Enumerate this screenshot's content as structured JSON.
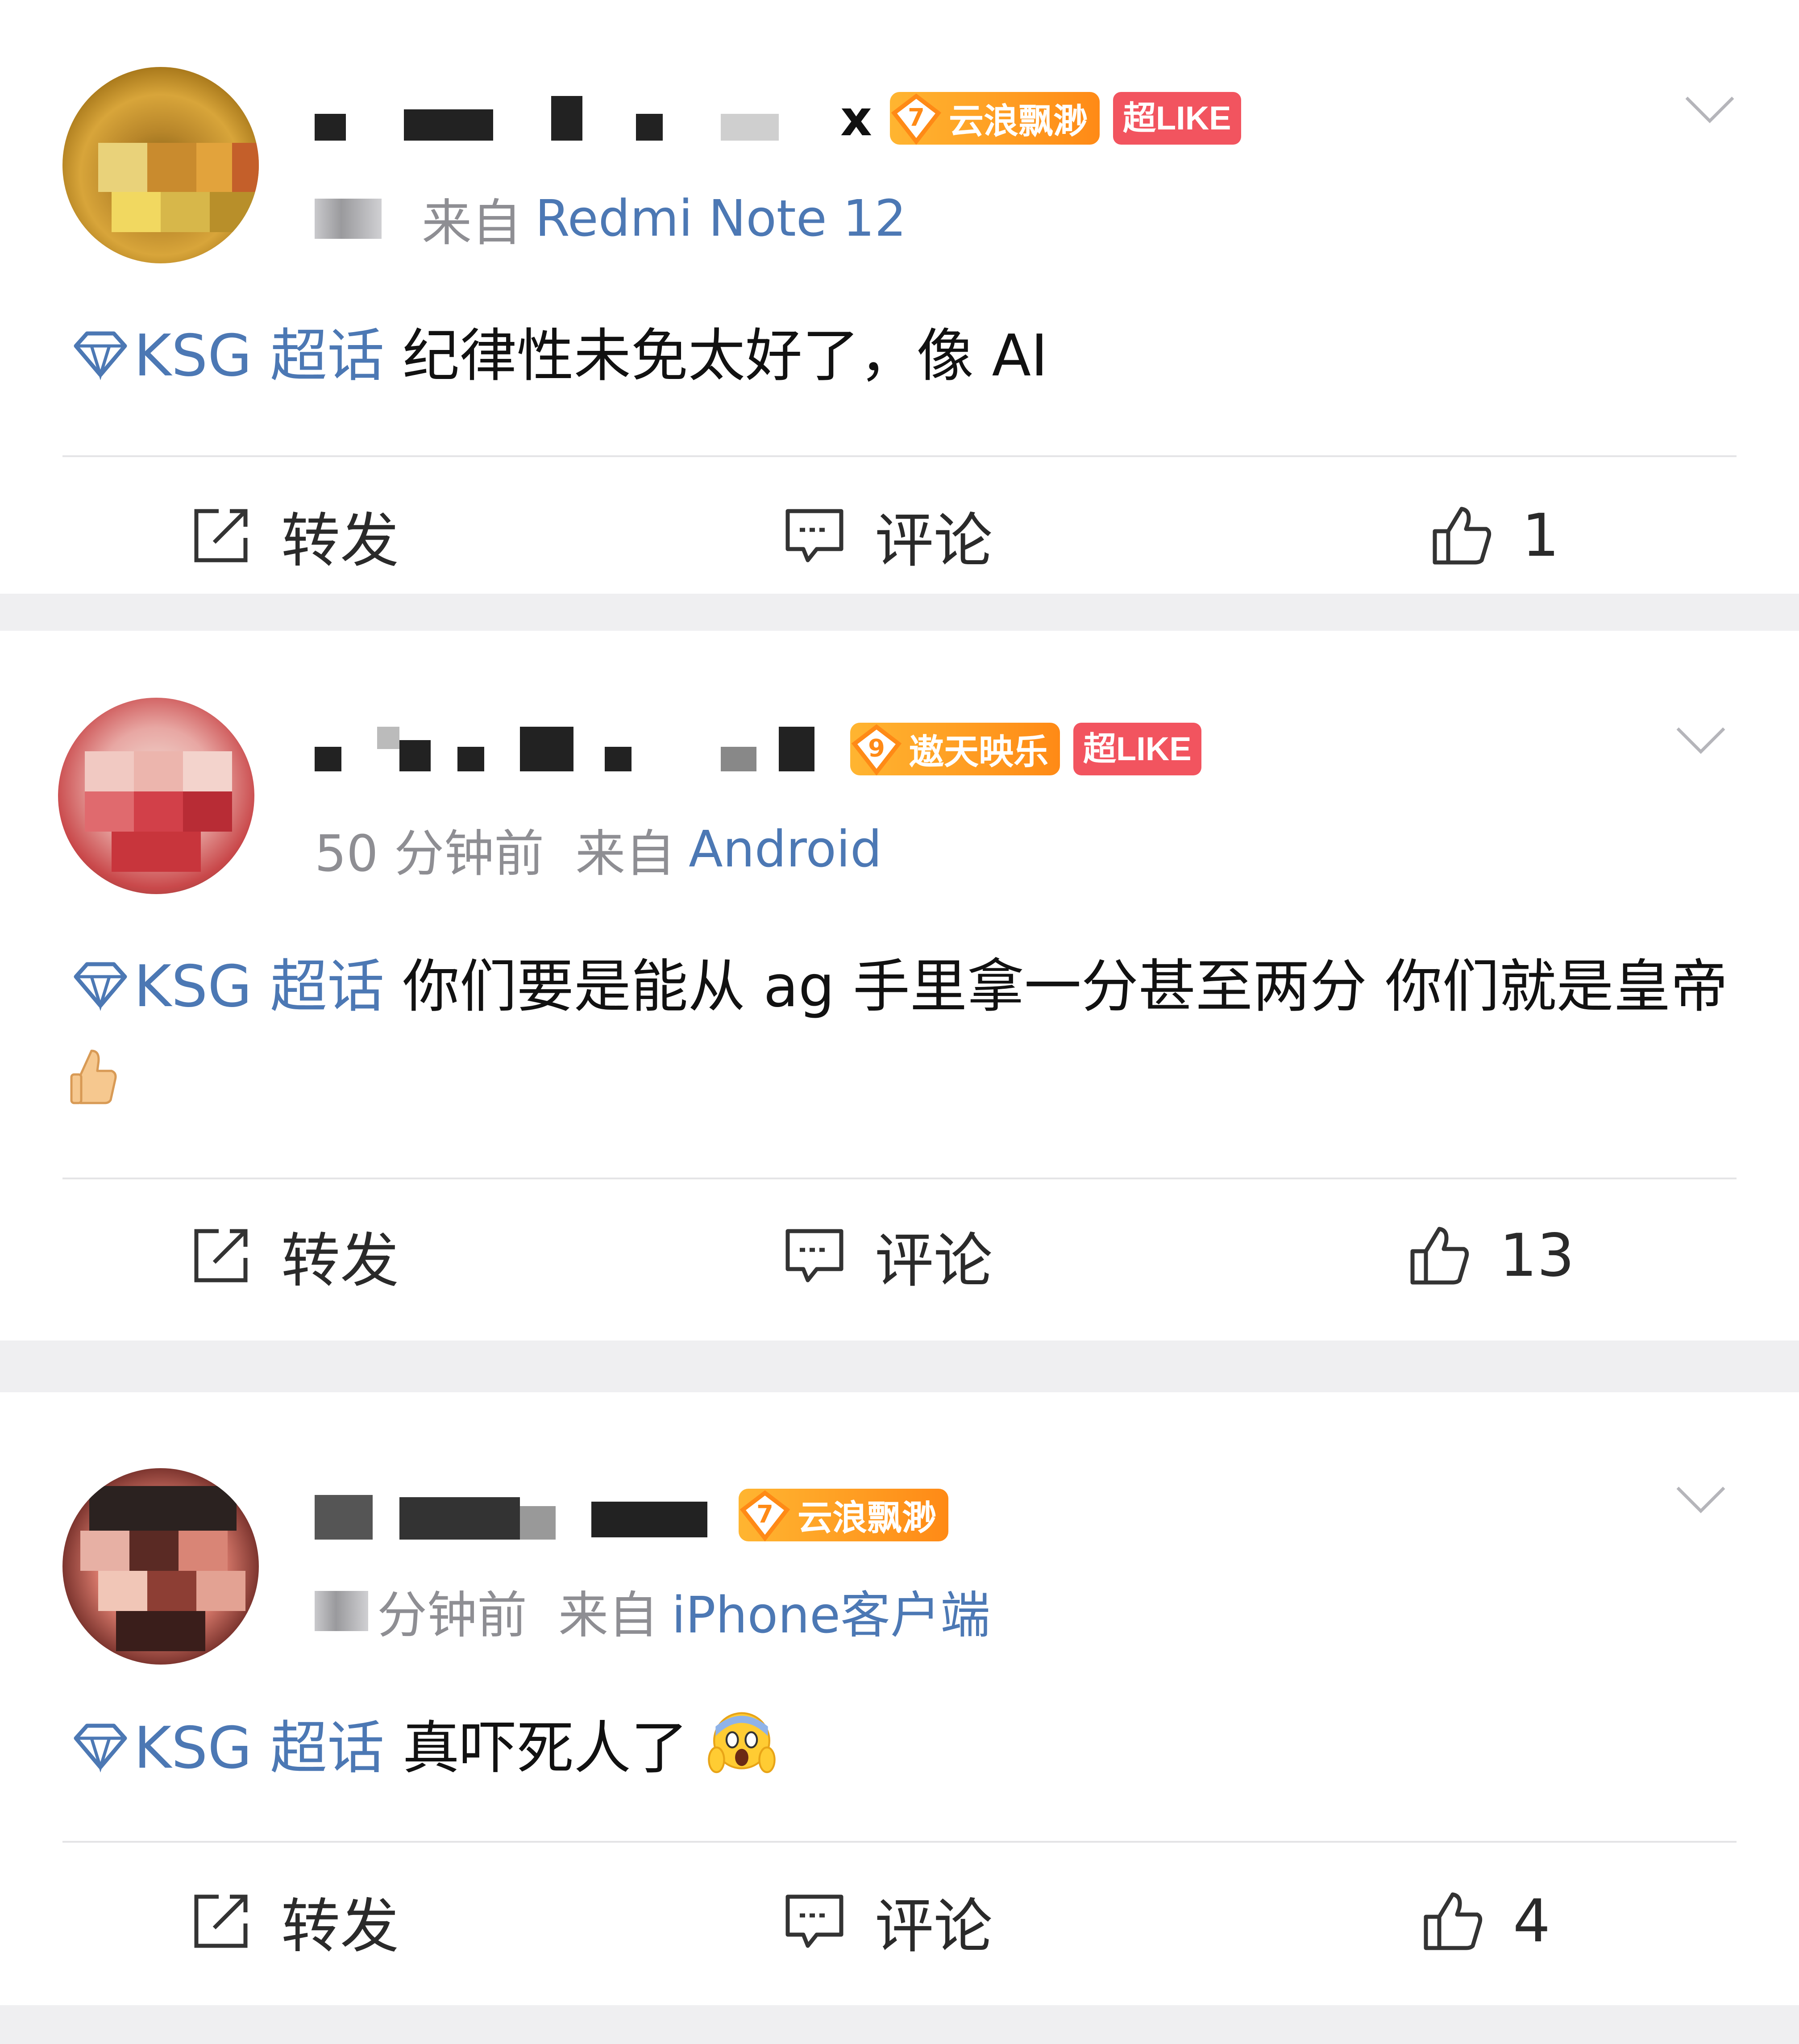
{
  "feed": {
    "posts": [
      {
        "user_name_visible_suffix": "x",
        "level_badge": {
          "level": "7",
          "title": "云浪飘渺",
          "color": "#ff9a1e"
        },
        "super_like_badge": "超LIKE",
        "meta": {
          "time": "",
          "from_label": "来自",
          "device": "Redmi Note 12"
        },
        "topic": "KSG 超话",
        "text": "纪律性未免太好了，像 AI",
        "actions": {
          "repost": "转发",
          "comment": "评论",
          "like_count": "1"
        }
      },
      {
        "user_name_visible_suffix": "",
        "level_badge": {
          "level": "9",
          "title": "遨天映乐",
          "color": "#ff9a1e"
        },
        "super_like_badge": "超LIKE",
        "meta": {
          "time": "50 分钟前",
          "from_label": "来自",
          "device": "Android"
        },
        "topic": "KSG 超话",
        "text": "你们要是能从 ag 手里拿一分甚至两分 你们就是皇帝",
        "actions": {
          "repost": "转发",
          "comment": "评论",
          "like_count": "13"
        }
      },
      {
        "user_name_visible_suffix": "",
        "level_badge": {
          "level": "7",
          "title": "云浪飘渺",
          "color": "#ff9a1e"
        },
        "super_like_badge": "",
        "meta": {
          "time": "分钟前",
          "from_label": "来自",
          "device": "iPhone客户端"
        },
        "topic": "KSG 超话",
        "text": "真吓死人了",
        "actions": {
          "repost": "转发",
          "comment": "评论",
          "like_count": "4"
        }
      }
    ]
  },
  "icons": {
    "topic": "diamond-icon",
    "repost": "repost-icon",
    "comment": "comment-icon",
    "like": "thumbs-up-icon",
    "menu": "chevron-down-icon"
  },
  "colors": {
    "link_blue": "#4c78b4",
    "meta_gray": "#8e8e93",
    "super_like_red": "#f2545f",
    "level_orange": "#ff9a1e",
    "page_background": "#efeff1"
  }
}
